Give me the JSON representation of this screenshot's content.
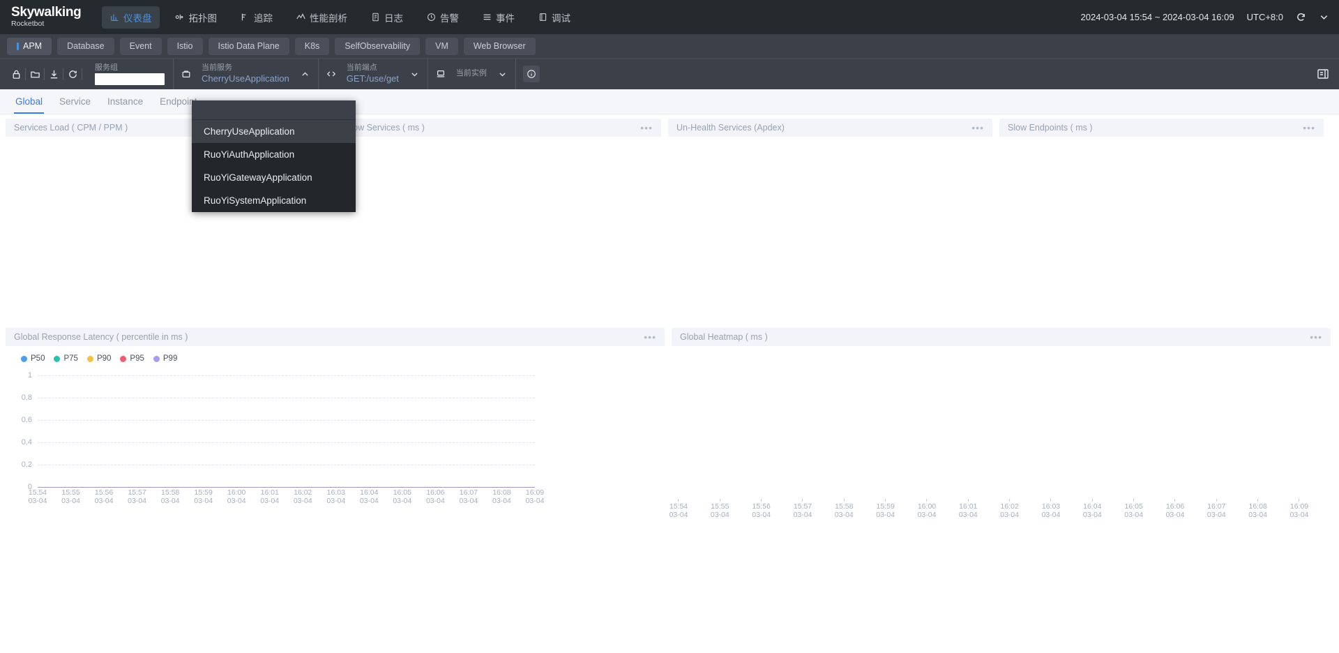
{
  "brand": {
    "name": "Skywalking",
    "sub": "Rocketbot"
  },
  "topnav": {
    "items": [
      {
        "label": "仪表盘",
        "icon": "dashboard-icon",
        "active": true
      },
      {
        "label": "拓扑图",
        "icon": "topology-icon",
        "active": false
      },
      {
        "label": "追踪",
        "icon": "trace-icon",
        "active": false
      },
      {
        "label": "性能剖析",
        "icon": "profile-icon",
        "active": false
      },
      {
        "label": "日志",
        "icon": "log-icon",
        "active": false
      },
      {
        "label": "告警",
        "icon": "alarm-icon",
        "active": false
      },
      {
        "label": "事件",
        "icon": "event-icon",
        "active": false
      },
      {
        "label": "调试",
        "icon": "debug-icon",
        "active": false
      }
    ],
    "time_range": "2024-03-04 15:54 ~ 2024-03-04 16:09",
    "timezone": "UTC+8:0",
    "reload_icon": "refresh-icon",
    "expand_icon": "chevron-down-icon"
  },
  "tabs": [
    {
      "label": "APM",
      "active": true
    },
    {
      "label": "Database",
      "active": false
    },
    {
      "label": "Event",
      "active": false
    },
    {
      "label": "Istio",
      "active": false
    },
    {
      "label": "Istio Data Plane",
      "active": false
    },
    {
      "label": "K8s",
      "active": false
    },
    {
      "label": "SelfObservability",
      "active": false
    },
    {
      "label": "VM",
      "active": false
    },
    {
      "label": "Web Browser",
      "active": false
    }
  ],
  "controlbar": {
    "icons": [
      {
        "name": "lock-icon"
      },
      {
        "name": "folder-icon"
      },
      {
        "name": "download-icon"
      },
      {
        "name": "refresh-icon"
      }
    ],
    "service_group": {
      "label": "服务组",
      "value": "",
      "placeholder": ""
    },
    "current_service": {
      "label": "当前服务",
      "value": "CherryUseApplication",
      "icon": "service-icon",
      "caret": "chevron-up-icon"
    },
    "current_endpoint": {
      "label": "当前端点",
      "value": "GET:/use/get",
      "icon": "code-icon",
      "caret": "chevron-down-icon"
    },
    "current_instance": {
      "label": "当前实例",
      "value": "",
      "icon": "instance-icon",
      "caret": "chevron-down-icon"
    },
    "info_icon": "info-icon",
    "collapse_icon": "panel-collapse-icon"
  },
  "service_dropdown": {
    "search_value": "",
    "options": [
      {
        "label": "CherryUseApplication",
        "selected": true
      },
      {
        "label": "RuoYiAuthApplication",
        "selected": false
      },
      {
        "label": "RuoYiGatewayApplication",
        "selected": false
      },
      {
        "label": "RuoYiSystemApplication",
        "selected": false
      }
    ]
  },
  "subtabs": [
    {
      "label": "Global",
      "active": true
    },
    {
      "label": "Service",
      "active": false
    },
    {
      "label": "Instance",
      "active": false
    },
    {
      "label": "Endpoint",
      "active": false
    }
  ],
  "widgets": {
    "services_load": {
      "title": "Services Load ( CPM / PPM )"
    },
    "slow_services": {
      "title": "Slow Services ( ms )"
    },
    "unhealth_services": {
      "title": "Un-Health Services (Apdex)"
    },
    "slow_endpoints": {
      "title": "Slow Endpoints ( ms )"
    },
    "global_latency": {
      "title": "Global Response Latency ( percentile in ms )"
    },
    "global_heatmap": {
      "title": "Global Heatmap ( ms )"
    },
    "menu_glyph": "•••"
  },
  "chart_data": [
    {
      "type": "line",
      "title": "Global Response Latency ( percentile in ms )",
      "xlabel": "",
      "ylabel": "",
      "ylim": [
        0,
        1
      ],
      "yticks": [
        "0",
        "0.2",
        "0.4",
        "0.6",
        "0.8",
        "1"
      ],
      "grid": true,
      "legend_position": "top-left",
      "x": [
        "15:54\n03-04",
        "15:55\n03-04",
        "15:56\n03-04",
        "15:57\n03-04",
        "15:58\n03-04",
        "15:59\n03-04",
        "16:00\n03-04",
        "16:01\n03-04",
        "16:02\n03-04",
        "16:03\n03-04",
        "16:04\n03-04",
        "16:05\n03-04",
        "16:06\n03-04",
        "16:07\n03-04",
        "16:08\n03-04",
        "16:09\n03-04"
      ],
      "series": [
        {
          "name": "P50",
          "color": "#4e9bf0",
          "values": [
            0,
            0,
            0,
            0,
            0,
            0,
            0,
            0,
            0,
            0,
            0,
            0,
            0,
            0,
            0,
            0
          ]
        },
        {
          "name": "P75",
          "color": "#27c3ae",
          "values": [
            0,
            0,
            0,
            0,
            0,
            0,
            0,
            0,
            0,
            0,
            0,
            0,
            0,
            0,
            0,
            0
          ]
        },
        {
          "name": "P90",
          "color": "#f5c243",
          "values": [
            0,
            0,
            0,
            0,
            0,
            0,
            0,
            0,
            0,
            0,
            0,
            0,
            0,
            0,
            0,
            0
          ]
        },
        {
          "name": "P95",
          "color": "#f4596d",
          "values": [
            0,
            0,
            0,
            0,
            0,
            0,
            0,
            0,
            0,
            0,
            0,
            0,
            0,
            0,
            0,
            0
          ]
        },
        {
          "name": "P99",
          "color": "#a79bf0",
          "values": [
            0,
            0,
            0,
            0,
            0,
            0,
            0,
            0,
            0,
            0,
            0,
            0,
            0,
            0,
            0,
            0
          ]
        }
      ]
    },
    {
      "type": "heatmap",
      "title": "Global Heatmap ( ms )",
      "xlabel": "",
      "ylabel": "",
      "grid": false,
      "x": [
        "15:54\n03-04",
        "15:55\n03-04",
        "15:56\n03-04",
        "15:57\n03-04",
        "15:58\n03-04",
        "15:59\n03-04",
        "16:00\n03-04",
        "16:01\n03-04",
        "16:02\n03-04",
        "16:03\n03-04",
        "16:04\n03-04",
        "16:05\n03-04",
        "16:06\n03-04",
        "16:07\n03-04",
        "16:08\n03-04",
        "16:09\n03-04"
      ],
      "values": []
    }
  ]
}
